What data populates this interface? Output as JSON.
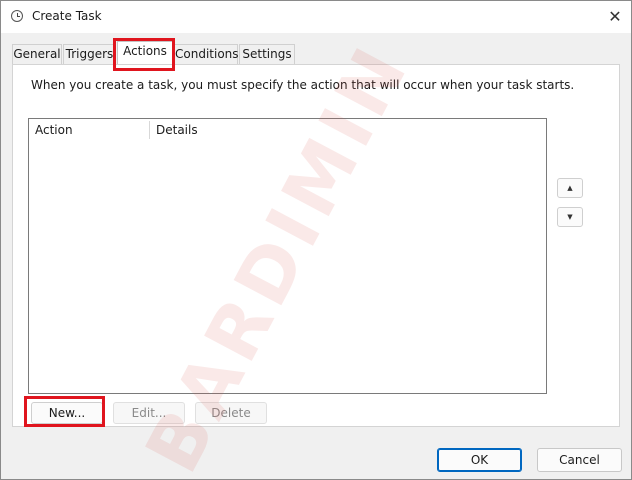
{
  "window": {
    "title": "Create Task"
  },
  "tabs": [
    {
      "label": "General"
    },
    {
      "label": "Triggers"
    },
    {
      "label": "Actions"
    },
    {
      "label": "Conditions"
    },
    {
      "label": "Settings"
    }
  ],
  "actions_tab": {
    "description": "When you create a task, you must specify the action that will occur when your task starts.",
    "columns": [
      "Action",
      "Details"
    ],
    "rows": [],
    "buttons": {
      "new": "New...",
      "edit": "Edit...",
      "delete": "Delete"
    }
  },
  "dialog_buttons": {
    "ok": "OK",
    "cancel": "Cancel"
  },
  "watermark": {
    "text": "BARDIMIN"
  },
  "colors": {
    "highlight": "#e0151e",
    "accent": "#0067c0",
    "watermark": "#d9534f"
  },
  "icons": {
    "title": "task-clock-icon",
    "close": "close-icon",
    "up": "chevron-up-icon",
    "down": "chevron-down-icon"
  }
}
